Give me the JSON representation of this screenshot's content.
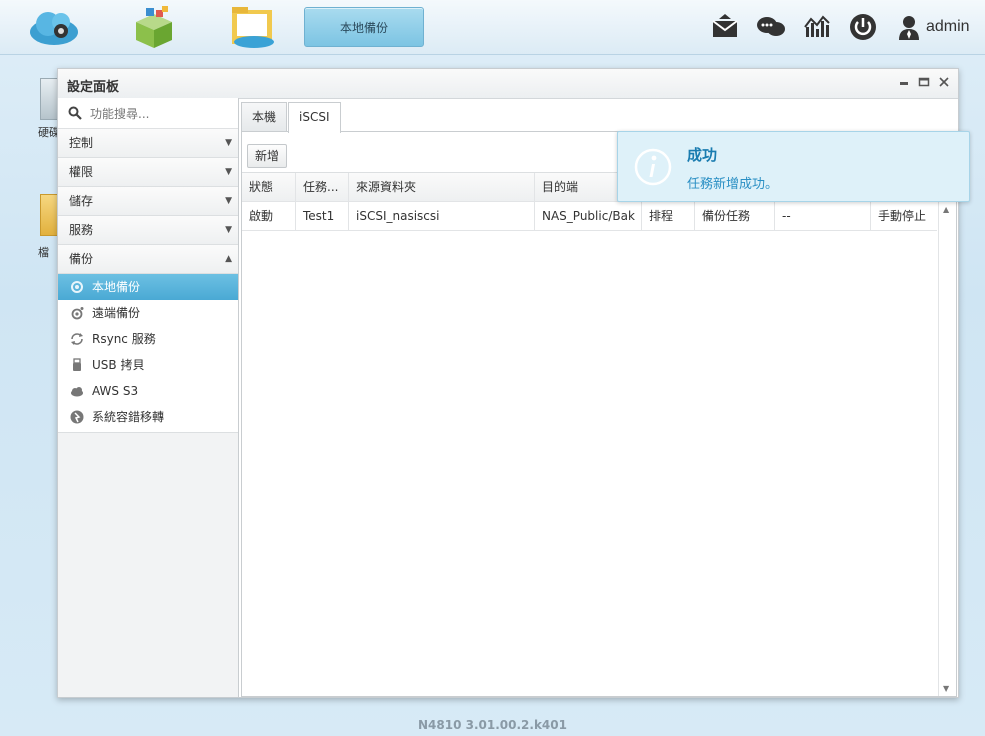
{
  "topbar": {
    "task_button_label": "本地備份",
    "apps": [
      "cloud-icon",
      "app-store-icon",
      "folder-icon"
    ],
    "user_label": "admin"
  },
  "desktop": {
    "label_1": "硬碟",
    "label_2": "檔"
  },
  "window": {
    "title": "設定面板"
  },
  "sidebar": {
    "search_placeholder": "功能搜尋...",
    "categories": [
      {
        "label": "控制",
        "arrow": "▼"
      },
      {
        "label": "權限",
        "arrow": "▼"
      },
      {
        "label": "儲存",
        "arrow": "▼"
      },
      {
        "label": "服務",
        "arrow": "▼"
      },
      {
        "label": "備份",
        "arrow": "▲"
      }
    ],
    "items": [
      {
        "label": "本地備份",
        "icon": "local-backup-icon"
      },
      {
        "label": "遠端備份",
        "icon": "remote-backup-icon"
      },
      {
        "label": "Rsync 服務",
        "icon": "sync-icon"
      },
      {
        "label": "USB 拷貝",
        "icon": "usb-icon"
      },
      {
        "label": "AWS S3",
        "icon": "cloud-small-icon"
      },
      {
        "label": "系統容錯移轉",
        "icon": "failover-icon"
      }
    ]
  },
  "content": {
    "tabs": [
      "本機",
      "iSCSI"
    ],
    "add_button": "新增",
    "columns": [
      "狀態",
      "任務...",
      "來源資料夾",
      "目的端",
      "",
      "",
      "",
      ""
    ],
    "rows": [
      [
        "啟動",
        "Test1",
        "iSCSI_nasiscsi",
        "NAS_Public/Bak",
        "排程",
        "備份任務",
        "--",
        "手動停止"
      ]
    ]
  },
  "toast": {
    "title": "成功",
    "message": "任務新增成功。"
  },
  "footer": {
    "version": "N4810   3.01.00.2.k401"
  },
  "colors": {
    "accent": "#4aa9d4",
    "toast_bg": "#def1f9",
    "toast_title": "#1a7cb0"
  }
}
